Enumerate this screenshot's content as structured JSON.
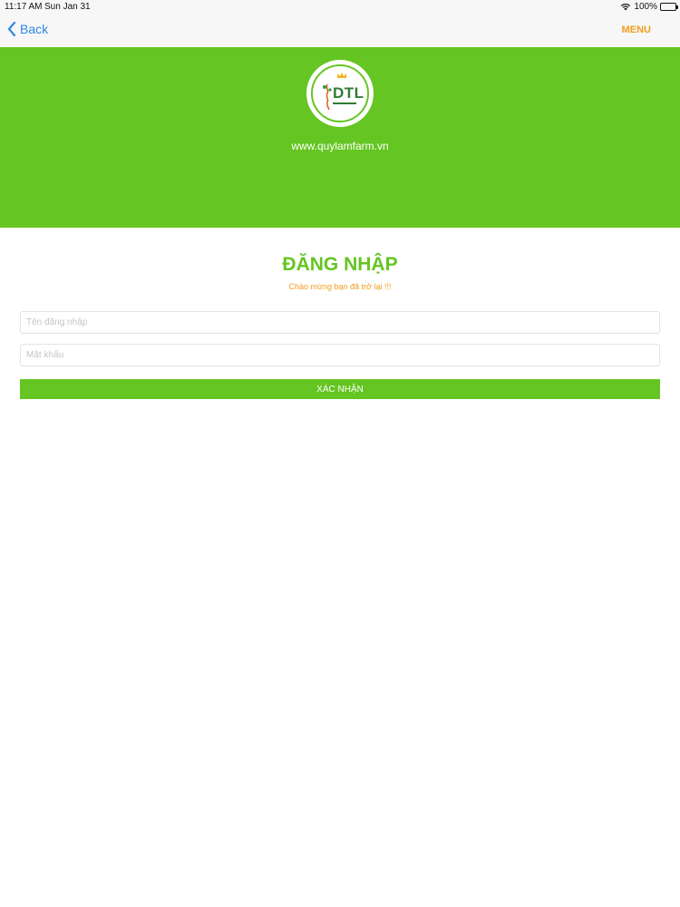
{
  "status_bar": {
    "time": "11:17 AM",
    "date": "Sun Jan 31",
    "battery": "100%"
  },
  "nav": {
    "back_label": "Back",
    "menu_label": "MENU"
  },
  "hero": {
    "logo_text": "DTL",
    "website": "www.quylamfarm.vn"
  },
  "login": {
    "title": "ĐĂNG NHẬP",
    "subtitle": "Chào mừng bạn đã trở lại !!!",
    "username_placeholder": "Tên đăng nhập",
    "password_placeholder": "Mật khẩu",
    "submit_label": "XÁC NHẬN"
  },
  "colors": {
    "brand_green": "#65c522",
    "accent_orange": "#f39c1f",
    "link_blue": "#2f86e6"
  }
}
